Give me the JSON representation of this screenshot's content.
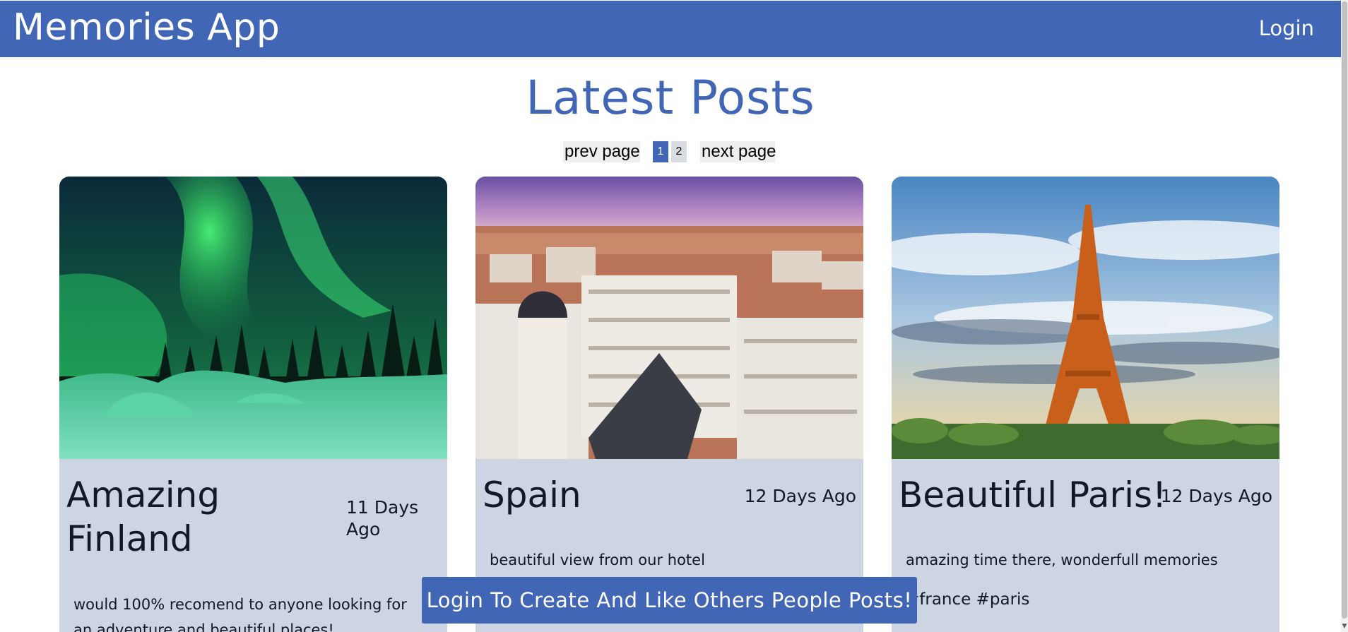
{
  "app": {
    "title": "Memories App",
    "login_label": "Login"
  },
  "main": {
    "heading": "Latest Posts"
  },
  "pagination": {
    "prev_label": "prev page",
    "next_label": "next page",
    "pages": [
      "1",
      "2"
    ],
    "current_page": "1"
  },
  "posts": [
    {
      "title": "Amazing Finland",
      "date": "11 Days Ago",
      "message": "would 100% recomend to anyone looking for an adventure and beautiful places!",
      "tags": "",
      "image": "northern-lights-photo"
    },
    {
      "title": "Spain",
      "date": "12 Days Ago",
      "message": "beautiful view from our hotel",
      "tags": "",
      "image": "madrid-city-photo"
    },
    {
      "title": "Beautiful Paris!",
      "date": "12 Days Ago",
      "message": "amazing time there, wonderfull memories",
      "tags": "#france #paris",
      "image": "eiffel-tower-photo"
    }
  ],
  "banner": {
    "text": "Login To Create And Like Others People Posts!"
  },
  "colors": {
    "primary": "#4266b6",
    "card_bg": "#ccd5e1",
    "text": "#111827"
  }
}
